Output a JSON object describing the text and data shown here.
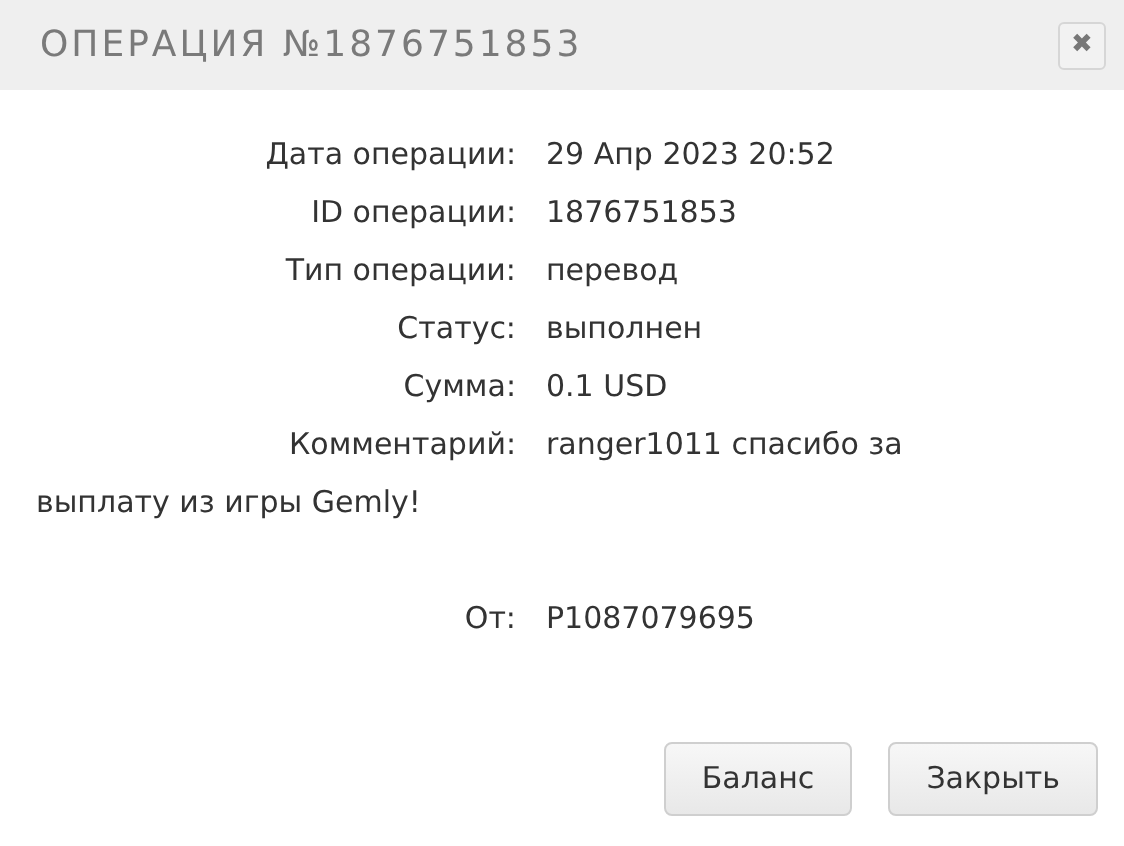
{
  "dialog": {
    "title": "ОПЕРАЦИЯ №1876751853",
    "close_label": "✖"
  },
  "fields": [
    {
      "label": "Дата операции:",
      "value": "29 Апр 2023 20:52"
    },
    {
      "label": "ID операции:",
      "value": "1876751853"
    },
    {
      "label": "Тип операции:",
      "value": "перевод"
    },
    {
      "label": "Статус:",
      "value": "выполнен"
    },
    {
      "label": "Сумма:",
      "value": "0.1 USD"
    }
  ],
  "comment": {
    "label": "Комментарий:",
    "lines": [
      "ranger1011 спасибо за",
      "выплату из игры Gemly!"
    ]
  },
  "sender": {
    "label": "От:",
    "value": "P1087079695"
  },
  "buttons": [
    "Баланс",
    "Закрыть"
  ]
}
